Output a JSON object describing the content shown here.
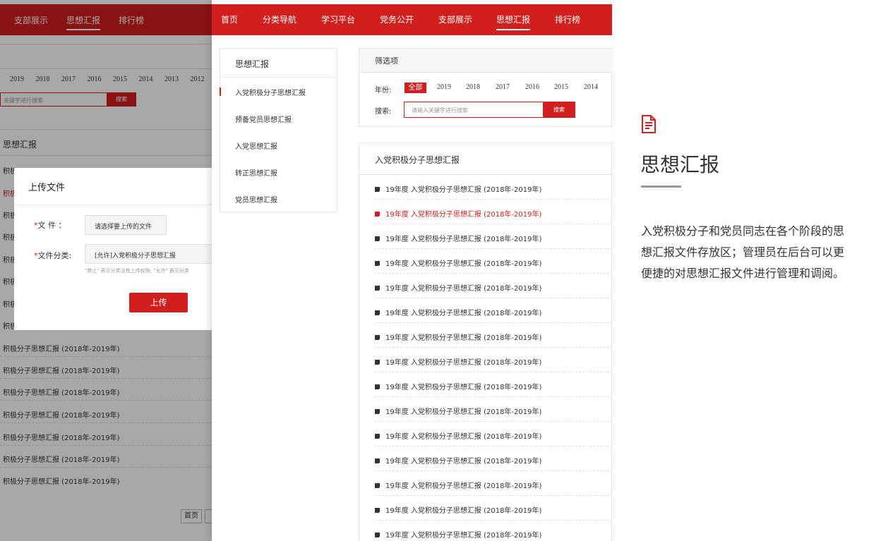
{
  "back": {
    "nav": [
      "支部展示",
      "思想汇报",
      "排行榜"
    ],
    "years": [
      "2019",
      "2018",
      "2017",
      "2016",
      "2015",
      "2014",
      "2013",
      "2012"
    ],
    "search_placeholder": "关键字进行搜索",
    "search_button": "搜索",
    "section_title": "思想汇报",
    "rows": [
      "积极分子思想汇报 (2018年-2019年)",
      "积极分子思想汇报 (2018年-2019年)",
      "积极分子思想汇报 (2018年-2019年)",
      "积极分子思想汇报 (2018年-2019年)",
      "积极分子思想汇报 (2018年-2019年)",
      "积极分子思想汇报 (2018年-2019年)",
      "积极分子思想汇报 (2018年-2019年)"
    ],
    "stub_rows": [
      "积极",
      "积极",
      "积极",
      "积极",
      "积极",
      "积极",
      "积极",
      "积极"
    ],
    "first_page": "首页"
  },
  "modal": {
    "title": "上传文件",
    "file_label_star": "*",
    "file_label": "文  件  ：",
    "file_button": "请选择要上传的文件",
    "category_label_star": "*",
    "category_label": "文件分类:",
    "category_value": "[允许]入党积极分子思想汇报",
    "hint": "\"禁止\" 表示分类没有上传权限; \"允许\" 表示分类",
    "upload_button": "上传"
  },
  "front": {
    "nav": [
      "首页",
      "分类导航",
      "学习平台",
      "党务公开",
      "支部展示",
      "思想汇报",
      "排行榜"
    ],
    "active_nav": "思想汇报",
    "sidebar": {
      "title": "思想汇报",
      "items": [
        "入党积极分子思想汇报",
        "预备党员思想汇报",
        "入党思想汇报",
        "转正思想汇报",
        "党员思想汇报"
      ]
    },
    "filter": {
      "title": "筛选项",
      "year_label": "年份:",
      "all_label": "全部",
      "years": [
        "2019",
        "2018",
        "2017",
        "2016",
        "2015",
        "2014"
      ],
      "search_label": "搜索:",
      "search_placeholder": "请输入关键字进行搜索",
      "search_button": "搜索"
    },
    "list": {
      "title": "入党积极分子思想汇报",
      "items": [
        "19年度 入党积极分子思想汇报 (2018年-2019年)",
        "19年度 入党积极分子思想汇报 (2018年-2019年)",
        "19年度 入党积极分子思想汇报 (2018年-2019年)",
        "19年度 入党积极分子思想汇报 (2018年-2019年)",
        "19年度 入党积极分子思想汇报 (2018年-2019年)",
        "19年度 入党积极分子思想汇报 (2018年-2019年)",
        "19年度 入党积极分子思想汇报 (2018年-2019年)",
        "19年度 入党积极分子思想汇报 (2018年-2019年)",
        "19年度 入党积极分子思想汇报 (2018年-2019年)",
        "19年度 入党积极分子思想汇报 (2018年-2019年)",
        "19年度 入党积极分子思想汇报 (2018年-2019年)",
        "19年度 入党积极分子思想汇报 (2018年-2019年)",
        "19年度 入党积极分子思想汇报 (2018年-2019年)",
        "19年度 入党积极分子思想汇报 (2018年-2019年)",
        "19年度 入党积极分子思想汇报 (2018年-2019年)"
      ]
    }
  },
  "description": {
    "icon": "document-icon",
    "title": "思想汇报",
    "text": "入党积极分子和党员同志在各个阶段的思想汇报文件存放区；管理员在后台可以更便捷的对思想汇报文件进行管理和调阅。"
  },
  "colors": {
    "accent": "#d11e1e",
    "text": "#333333",
    "muted": "#999999"
  }
}
